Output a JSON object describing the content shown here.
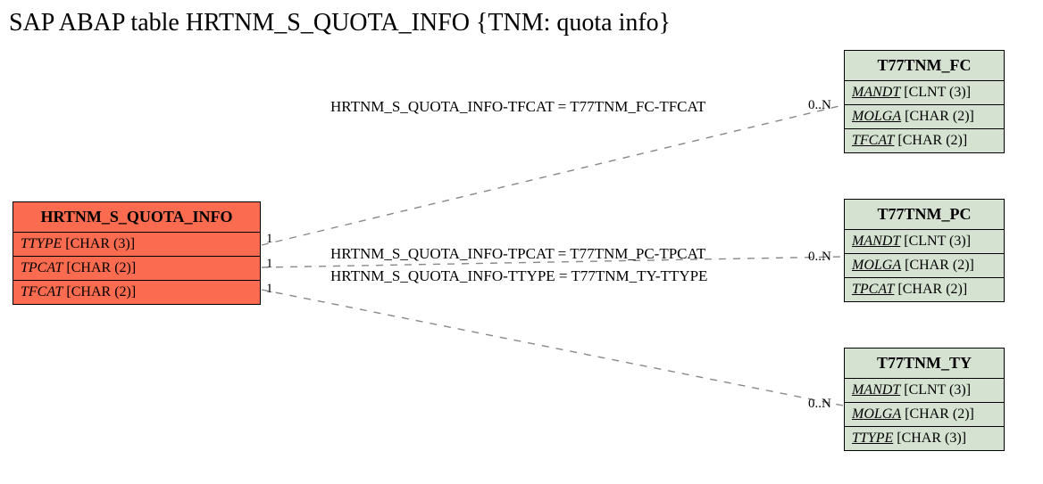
{
  "title": "SAP ABAP table HRTNM_S_QUOTA_INFO {TNM: quota info}",
  "entities": {
    "hrtnm": {
      "name": "HRTNM_S_QUOTA_INFO",
      "fields": [
        {
          "name": "TTYPE",
          "type": "[CHAR (3)]",
          "underline": false
        },
        {
          "name": "TPCAT",
          "type": "[CHAR (2)]",
          "underline": false
        },
        {
          "name": "TFCAT",
          "type": "[CHAR (2)]",
          "underline": false
        }
      ]
    },
    "fc": {
      "name": "T77TNM_FC",
      "fields": [
        {
          "name": "MANDT",
          "type": "[CLNT (3)]",
          "underline": true
        },
        {
          "name": "MOLGA",
          "type": "[CHAR (2)]",
          "underline": true
        },
        {
          "name": "TFCAT",
          "type": "[CHAR (2)]",
          "underline": true
        }
      ]
    },
    "pc": {
      "name": "T77TNM_PC",
      "fields": [
        {
          "name": "MANDT",
          "type": "[CLNT (3)]",
          "underline": true
        },
        {
          "name": "MOLGA",
          "type": "[CHAR (2)]",
          "underline": true
        },
        {
          "name": "TPCAT",
          "type": "[CHAR (2)]",
          "underline": true
        }
      ]
    },
    "ty": {
      "name": "T77TNM_TY",
      "fields": [
        {
          "name": "MANDT",
          "type": "[CLNT (3)]",
          "underline": true
        },
        {
          "name": "MOLGA",
          "type": "[CHAR (2)]",
          "underline": true
        },
        {
          "name": "TTYPE",
          "type": "[CHAR (3)]",
          "underline": true
        }
      ]
    }
  },
  "relations": {
    "r_fc": {
      "label": "HRTNM_S_QUOTA_INFO-TFCAT = T77TNM_FC-TFCAT",
      "left_card": "1",
      "right_card": "0..N"
    },
    "r_pc": {
      "label": "HRTNM_S_QUOTA_INFO-TPCAT = T77TNM_PC-TPCAT",
      "left_card": "1",
      "right_card": "0..N"
    },
    "r_ty": {
      "label": "HRTNM_S_QUOTA_INFO-TTYPE = T77TNM_TY-TTYPE",
      "left_card": "1",
      "right_card": "0..N"
    }
  }
}
